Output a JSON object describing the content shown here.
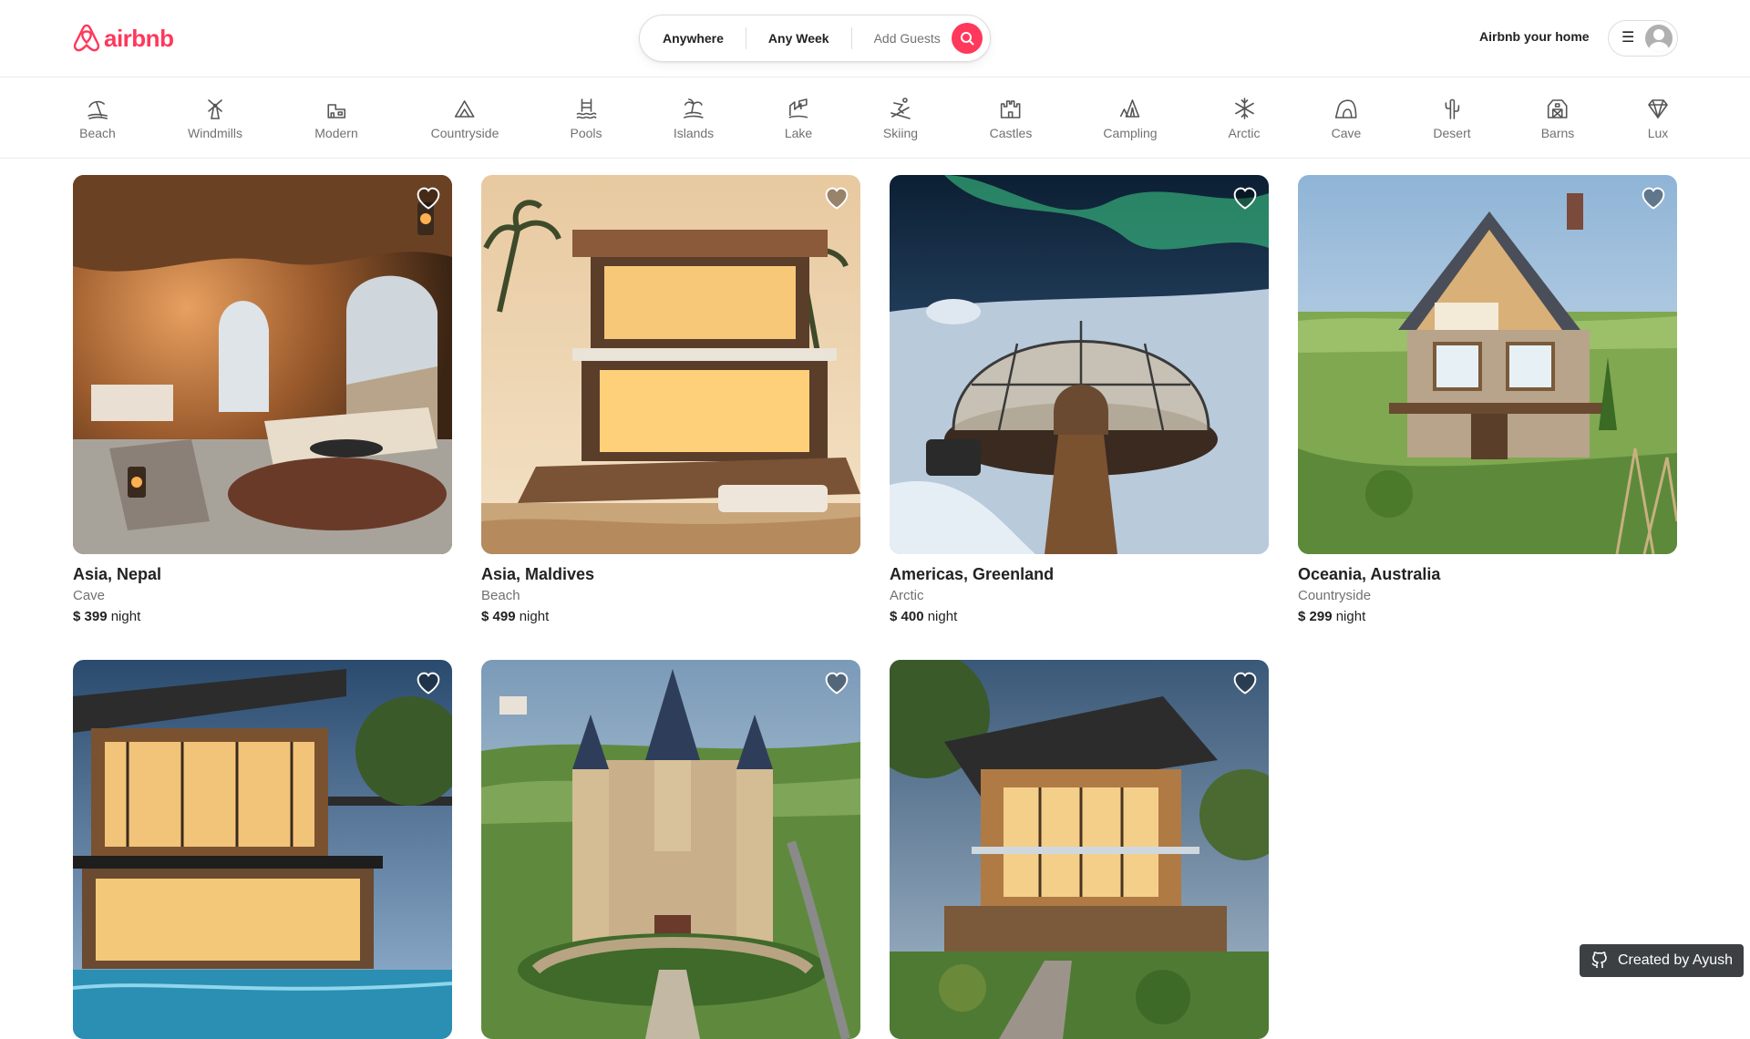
{
  "brand": {
    "name": "airbnb",
    "color": "#ff385c",
    "icon": "airbnb-logo-icon"
  },
  "search": {
    "location": "Anywhere",
    "week": "Any Week",
    "guests": "Add Guests",
    "button_icon": "search-icon"
  },
  "header": {
    "host_link": "Airbnb your home",
    "menu_icon": "hamburger-menu-icon",
    "avatar_icon": "user-avatar-icon"
  },
  "categories": [
    {
      "label": "Beach",
      "icon": "beach-icon"
    },
    {
      "label": "Windmills",
      "icon": "windmill-icon"
    },
    {
      "label": "Modern",
      "icon": "modern-house-icon"
    },
    {
      "label": "Countryside",
      "icon": "countryside-icon"
    },
    {
      "label": "Pools",
      "icon": "pool-icon"
    },
    {
      "label": "Islands",
      "icon": "island-icon"
    },
    {
      "label": "Lake",
      "icon": "lake-icon"
    },
    {
      "label": "Skiing",
      "icon": "skiing-icon"
    },
    {
      "label": "Castles",
      "icon": "castle-icon"
    },
    {
      "label": "Campling",
      "icon": "camping-icon"
    },
    {
      "label": "Arctic",
      "icon": "snowflake-icon"
    },
    {
      "label": "Cave",
      "icon": "cave-icon"
    },
    {
      "label": "Desert",
      "icon": "cactus-icon"
    },
    {
      "label": "Barns",
      "icon": "barn-icon"
    },
    {
      "label": "Lux",
      "icon": "diamond-icon"
    }
  ],
  "listings": [
    {
      "location": "Asia, Nepal",
      "category": "Cave",
      "price": "$ 399",
      "unit": "night",
      "image": "cave-interior-photo"
    },
    {
      "location": "Asia, Maldives",
      "category": "Beach",
      "price": "$ 499",
      "unit": "night",
      "image": "beach-villa-photo"
    },
    {
      "location": "Americas, Greenland",
      "category": "Arctic",
      "price": "$ 400",
      "unit": "night",
      "image": "glass-igloo-aurora-photo"
    },
    {
      "location": "Oceania, Australia",
      "category": "Countryside",
      "price": "$ 299",
      "unit": "night",
      "image": "countryside-cottage-photo"
    },
    {
      "location": "",
      "category": "",
      "price": "",
      "unit": "",
      "image": "modern-pool-house-photo"
    },
    {
      "location": "",
      "category": "",
      "price": "",
      "unit": "",
      "image": "castle-photo"
    },
    {
      "location": "",
      "category": "",
      "price": "",
      "unit": "",
      "image": "modern-wood-house-photo"
    }
  ],
  "badge": {
    "text": "Created by Ayush",
    "icon": "github-icon"
  },
  "colors": {
    "accent": "#ff385c",
    "text": "#222222",
    "muted": "#717171",
    "border": "#dddddd"
  }
}
